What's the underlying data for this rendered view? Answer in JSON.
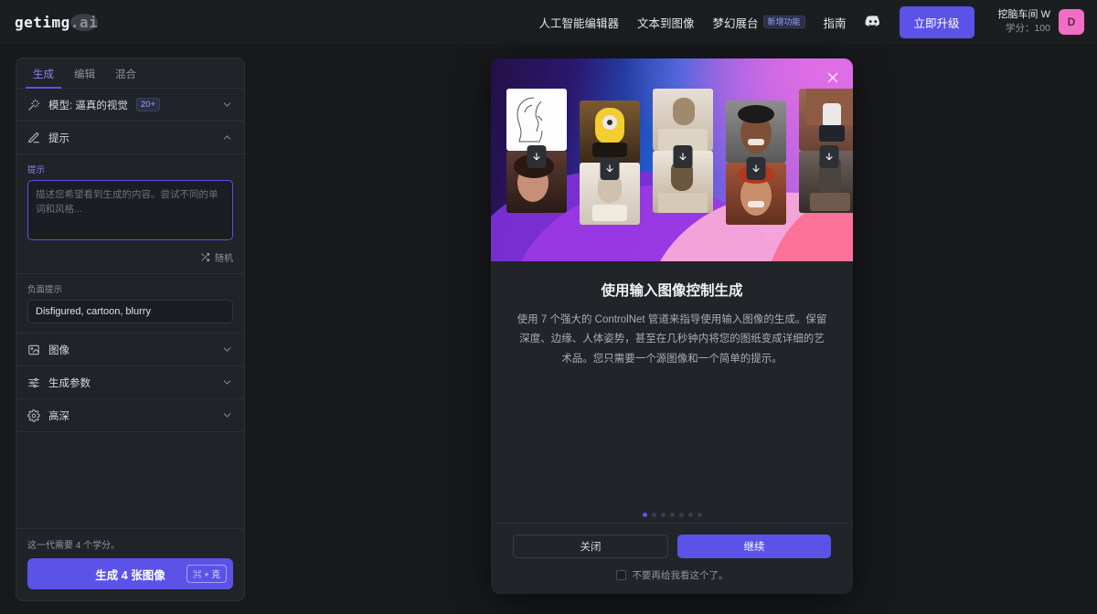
{
  "brand": {
    "name": "getimg",
    "suffix": ".ai"
  },
  "topnav": {
    "items": [
      {
        "label": "人工智能编辑器",
        "badge": ""
      },
      {
        "label": "文本到图像",
        "badge": ""
      },
      {
        "label": "梦幻展台",
        "badge": "新增功能"
      },
      {
        "label": "指南",
        "badge": ""
      }
    ],
    "discord_icon": "discord-icon",
    "upgrade_label": "立即升级",
    "user": {
      "name": "挖脑车间 W",
      "credits": "学分：100",
      "avatar_initial": "D"
    }
  },
  "sidebar": {
    "tabs": [
      {
        "label": "生成",
        "active": true
      },
      {
        "label": "编辑",
        "active": false
      },
      {
        "label": "混合",
        "active": false
      }
    ],
    "model_row": {
      "icon": "magic-wand-icon",
      "label": "模型: 逼真的视觉",
      "badge": "20+"
    },
    "prompt_row": {
      "icon": "pencil-icon",
      "label": "提示"
    },
    "prompt": {
      "label": "提示",
      "value": "",
      "placeholder": "描述您希望看到生成的内容。尝试不同的单词和风格...",
      "shuffle_label": "随机",
      "shuffle_icon": "shuffle-icon"
    },
    "negative_prompt": {
      "label": "负面提示",
      "value": "Disfigured, cartoon, blurry",
      "placeholder": ""
    },
    "sections": [
      {
        "icon": "image-icon",
        "label": "图像"
      },
      {
        "icon": "sliders-icon",
        "label": "生成参数"
      },
      {
        "icon": "gear-icon",
        "label": "高深"
      }
    ],
    "footer": {
      "credits_note": "这一代需要 4 个学分。",
      "generate_label": "生成 4 张图像",
      "shortcut": "⌘ + 克"
    }
  },
  "modal": {
    "close_icon": "close-icon",
    "title": "使用输入图像控制生成",
    "body": "使用 7 个强大的 ControlNet 管道来指导使用输入图像的生成。保留深度、边缘、人体姿势，甚至在几秒钟内将您的图纸变成详细的艺术品。您只需要一个源图像和一个简单的提示。",
    "pagination": {
      "total": 7,
      "active_index": 0
    },
    "close_label": "关闭",
    "continue_label": "继续",
    "dont_show_label": "不要再给我看这个了。",
    "hero_pairs": [
      {
        "top": "a-sketch",
        "bottom": "a-woman",
        "arrow_icon": "arrow-down-icon"
      },
      {
        "top": "a-minion",
        "bottom": "a-cat2",
        "arrow_icon": "arrow-down-icon"
      },
      {
        "top": "a-cat1",
        "bottom": "a-cat3",
        "arrow_icon": "arrow-down-icon"
      },
      {
        "top": "a-face1",
        "bottom": "a-face2",
        "arrow_icon": "arrow-down-icon"
      },
      {
        "top": "a-pose1",
        "bottom": "a-pose2",
        "arrow_icon": "arrow-down-icon"
      }
    ]
  },
  "colors": {
    "accent": "#5b52e8",
    "background": "#17191c",
    "panel": "#202327",
    "avatar": "#f06fc4",
    "badge_text": "#9aa4f5"
  }
}
